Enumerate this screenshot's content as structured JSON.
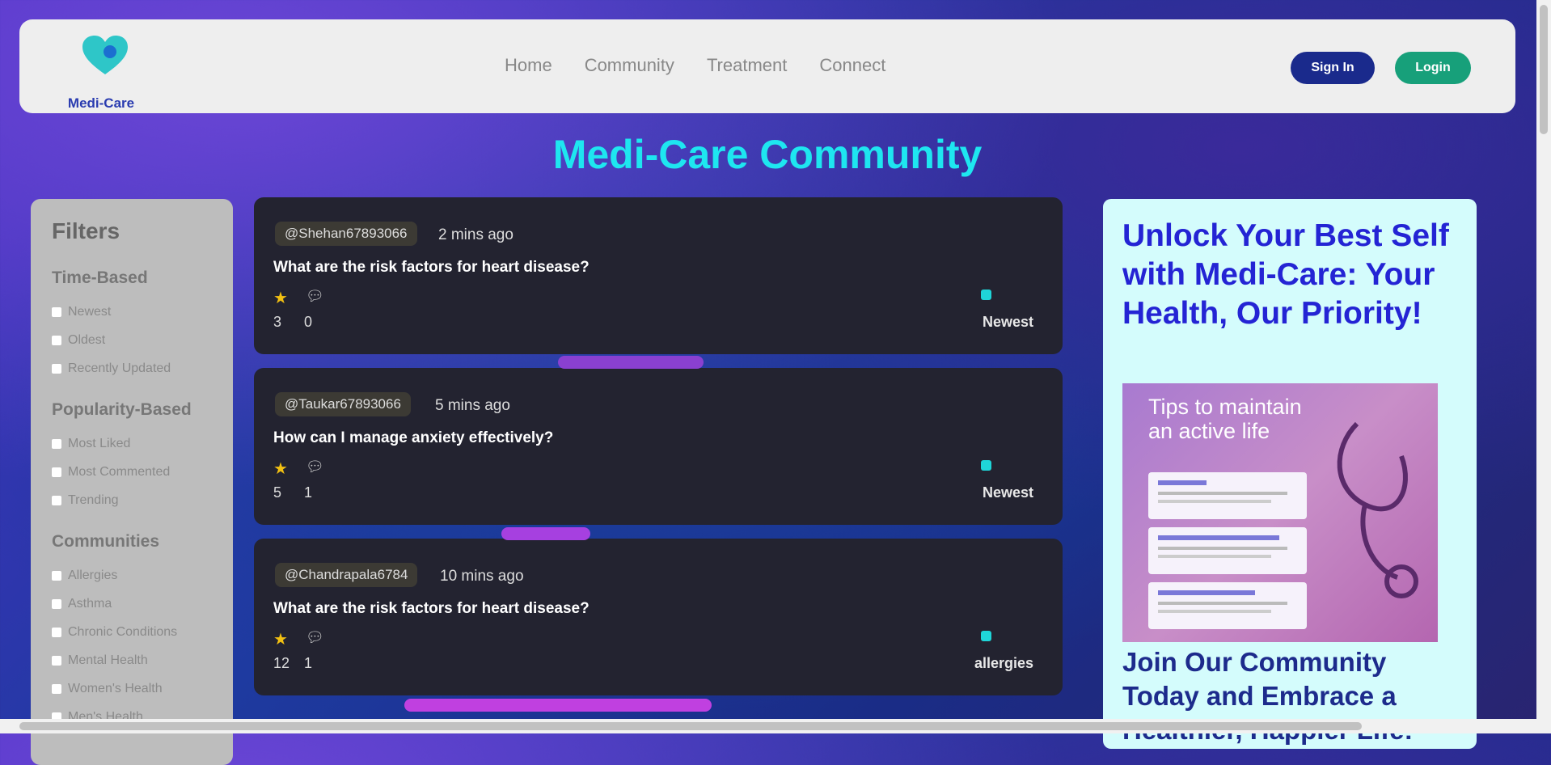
{
  "brand": {
    "name": "Medi-Care",
    "accent": "#1ee6f0"
  },
  "nav": {
    "links": [
      "Home",
      "Community",
      "Treatment",
      "Connect"
    ],
    "signin_label": "Sign In",
    "login_label": "Login"
  },
  "page": {
    "title": "Medi-Care Community"
  },
  "filters": {
    "title": "Filters",
    "groups": [
      {
        "label": "Time-Based",
        "options": [
          "Newest",
          "Oldest",
          "Recently Updated"
        ]
      },
      {
        "label": "Popularity-Based",
        "options": [
          "Most Liked",
          "Most Commented",
          "Trending"
        ]
      },
      {
        "label": "Communities",
        "options": [
          "Allergies",
          "Asthma",
          "Chronic Conditions",
          "Mental Health",
          "Women's Health",
          "Men's Health"
        ]
      }
    ]
  },
  "posts": [
    {
      "user": "@Shehan67893066",
      "time": "2 mins ago",
      "question": "What are the risk factors for heart disease?",
      "likes": "3",
      "comments": "0",
      "tag": "Newest"
    },
    {
      "user": "@Taukar67893066",
      "time": "5 mins ago",
      "question": "How can I manage anxiety effectively?",
      "likes": "5",
      "comments": "1",
      "tag": "Newest"
    },
    {
      "user": "@Chandrapala6784",
      "time": "10 mins ago",
      "question": "What are the risk factors for heart disease?",
      "likes": "12",
      "comments": "1",
      "tag": "allergies"
    }
  ],
  "promo": {
    "headline": "Unlock Your Best Self with Medi-Care: Your Health, Our Priority!",
    "image_caption": "Tips to maintain an active life",
    "cta": "Join Our Community Today and Embrace a Healthier, Happier Life!"
  }
}
